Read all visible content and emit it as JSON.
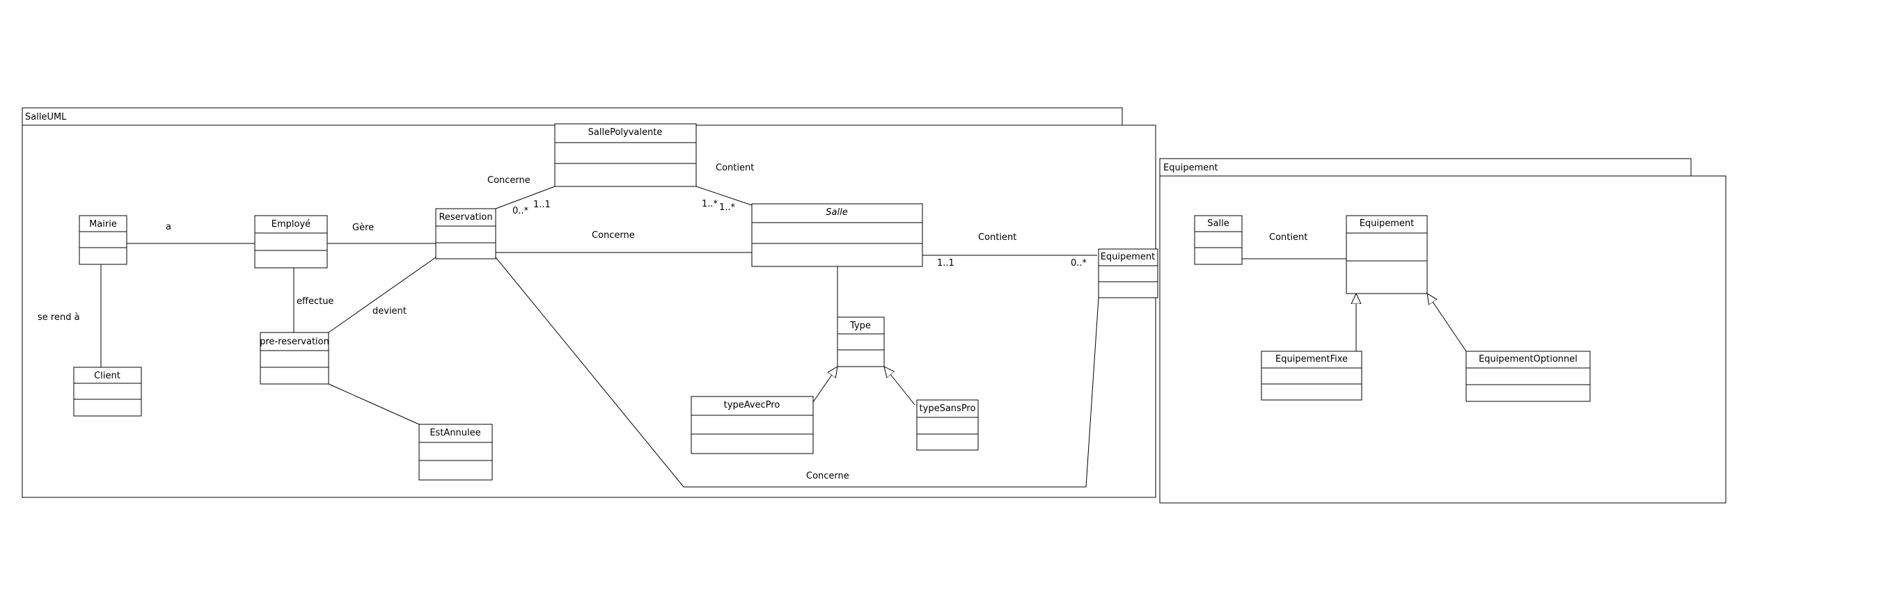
{
  "packages": {
    "salle_uml": {
      "name": "SalleUML"
    },
    "equipement": {
      "name": "Equipement"
    }
  },
  "classes": {
    "mairie": {
      "name": "Mairie"
    },
    "employe": {
      "name": "Employé"
    },
    "client": {
      "name": "Client"
    },
    "pre_reservation": {
      "name": "pre-reservation"
    },
    "reservation": {
      "name": "Reservation"
    },
    "est_annulee": {
      "name": "EstAnnulee"
    },
    "salle_polyvalente": {
      "name": "SallePolyvalente"
    },
    "salle": {
      "name": "Salle"
    },
    "type": {
      "name": "Type"
    },
    "type_avec_pro": {
      "name": "typeAvecPro"
    },
    "type_sans_pro": {
      "name": "typeSansPro"
    },
    "equipement_ref": {
      "name": "Equipement"
    },
    "salle_ref": {
      "name": "Salle"
    },
    "equipement_main": {
      "name": "Equipement"
    },
    "equipement_fixe": {
      "name": "EquipementFixe"
    },
    "equipement_optionnel": {
      "name": "EquipementOptionnel"
    }
  },
  "associations": {
    "a": "a",
    "gere": "Gère",
    "se_rend_a": "se rend à",
    "effectue": "effectue",
    "devient": "devient",
    "concerne_polyvalente": "Concerne",
    "concerne_salle": "Concerne",
    "concerne_equipement": "Concerne",
    "contient_polyvalente": "Contient",
    "contient_equipement": "Contient",
    "contient_pkg": "Contient"
  },
  "multiplicities": {
    "res_poly": "0..*",
    "poly_res": "1..1",
    "poly_salle_a": "1..*",
    "poly_salle_b": "1..*",
    "salle_equip": "1..1",
    "equip_salle": "0..*"
  }
}
